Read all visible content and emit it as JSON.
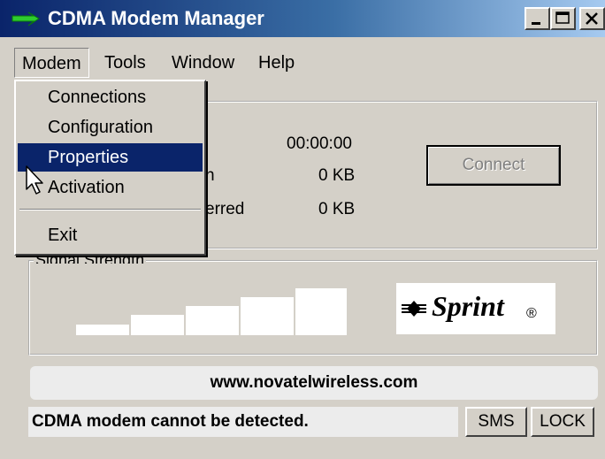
{
  "window": {
    "title": "CDMA Modem Manager",
    "logo_icon": "sprint-swoosh-icon"
  },
  "title_buttons": {
    "minimize": "minimize-icon",
    "maximize": "maximize-icon",
    "close": "close-icon"
  },
  "menubar": {
    "items": [
      {
        "label": "Modem"
      },
      {
        "label": "Tools"
      },
      {
        "label": "Window"
      },
      {
        "label": "Help"
      }
    ]
  },
  "dropdown": {
    "items": [
      {
        "label": "Connections"
      },
      {
        "label": "Configuration"
      },
      {
        "label": "Properties",
        "selected": true
      },
      {
        "label": "Activation"
      },
      {
        "label": "Exit"
      }
    ]
  },
  "connection": {
    "time_value": "00:00:00",
    "received_label_fragment": "n",
    "received_value": "0 KB",
    "transferred_label_fragment": "erred",
    "transferred_value": "0 KB",
    "connect_button": "Connect"
  },
  "signal": {
    "label": "Signal Strength",
    "bars": [
      1,
      2,
      3,
      4,
      5
    ],
    "level": 0
  },
  "brand": {
    "name": "Sprint",
    "mark": "®"
  },
  "footer": {
    "url": "www.novatelwireless.com",
    "status": "CDMA modem cannot be detected.",
    "sms_button": "SMS",
    "lock_button": "LOCK"
  },
  "colors": {
    "title_start": "#0a246a",
    "title_end": "#a6caf0",
    "selection": "#0a246a",
    "face": "#d4d0c8"
  }
}
